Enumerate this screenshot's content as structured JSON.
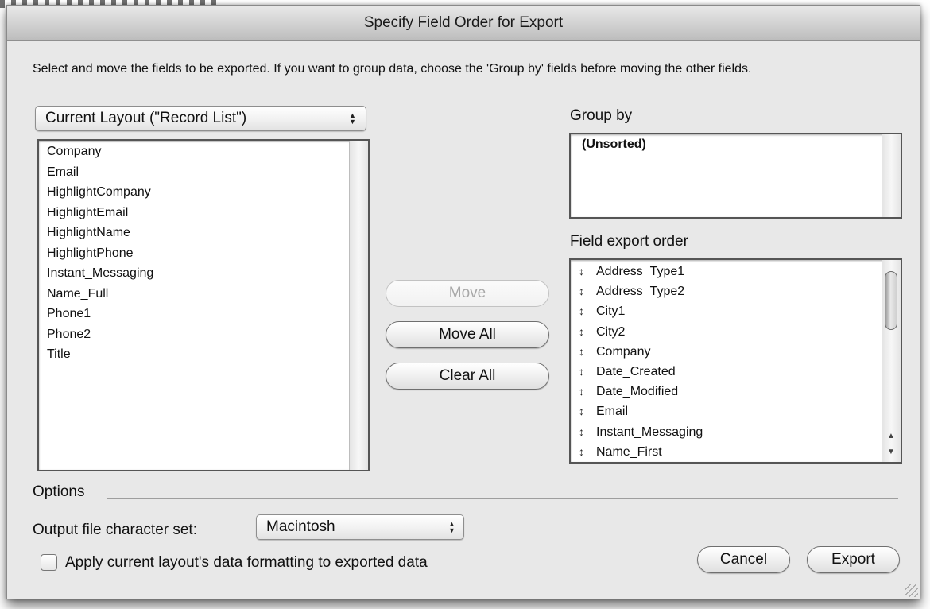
{
  "window": {
    "title": "Specify Field Order for Export"
  },
  "instructions": "Select and move the fields to be exported.  If you want to group data, choose the 'Group by' fields before moving the other fields.",
  "source": {
    "layout_popup": "Current Layout (\"Record List\")",
    "fields": [
      "Company",
      "Email",
      "HighlightCompany",
      "HighlightEmail",
      "HighlightName",
      "HighlightPhone",
      "Instant_Messaging",
      "Name_Full",
      "Phone1",
      "Phone2",
      "Title"
    ]
  },
  "actions": {
    "move": "Move",
    "move_all": "Move All",
    "clear_all": "Clear All"
  },
  "group_by": {
    "label": "Group by",
    "items": [
      "(Unsorted)"
    ]
  },
  "export_order": {
    "label": "Field export order",
    "items": [
      "Address_Type1",
      "Address_Type2",
      "City1",
      "City2",
      "Company",
      "Date_Created",
      "Date_Modified",
      "Email",
      "Instant_Messaging",
      "Name_First"
    ]
  },
  "options": {
    "label": "Options",
    "charset_label": "Output file character set:",
    "charset_value": "Macintosh",
    "formatting_checkbox_label": "Apply current layout's data formatting to exported data",
    "formatting_checked": false
  },
  "footer": {
    "cancel": "Cancel",
    "export": "Export"
  },
  "icons": {
    "popup_arrows": "up-down-arrows-icon",
    "reorder_grip": "reorder-grip-icon",
    "scroll_up": "scroll-up-arrow-icon",
    "scroll_down": "scroll-down-arrow-icon"
  }
}
